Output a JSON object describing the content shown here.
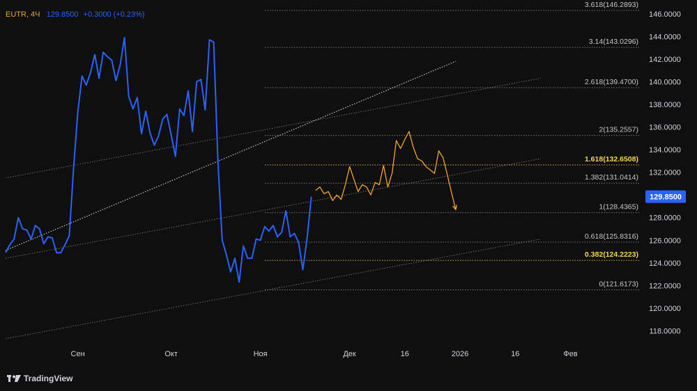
{
  "legend": {
    "symbol": "EUTR, 4Ч",
    "last": "129.8500",
    "change": "+0.3000 (+0.23%)"
  },
  "brand": {
    "name": "TradingView",
    "icon": "tradingview-logo-icon"
  },
  "colors": {
    "background": "#0f0f0f",
    "price_line": "#2962ff",
    "forecast": "#f5a623",
    "fib_level": "#9a9a9a",
    "fib_highlight": "#e3c54a",
    "axis_text": "#d1d4dc",
    "trend_line": "#cfcfcf"
  },
  "chart_data": {
    "type": "line",
    "y_axis": {
      "ylim": [
        116.8,
        146.6
      ],
      "ticks": [
        "118.0000",
        "120.0000",
        "122.0000",
        "124.0000",
        "126.0000",
        "128.0000",
        "130.0000",
        "132.0000",
        "134.0000",
        "136.0000",
        "138.0000",
        "140.0000",
        "142.0000",
        "144.0000",
        "146.0000"
      ],
      "tick_values": [
        118,
        120,
        122,
        124,
        126,
        128,
        130,
        132,
        134,
        136,
        138,
        140,
        142,
        144,
        146
      ],
      "last_price_label": "129.8500",
      "last_price_value": 129.85
    },
    "x_axis": {
      "xlim": [
        0,
        150
      ],
      "ticks": [
        {
          "label": "Сен",
          "x": 17
        },
        {
          "label": "Окт",
          "x": 39
        },
        {
          "label": "Ноя",
          "x": 60
        },
        {
          "label": "Дек",
          "x": 81
        },
        {
          "label": "16",
          "x": 94
        },
        {
          "label": "2026",
          "x": 107
        },
        {
          "label": "16",
          "x": 120
        },
        {
          "label": "Фев",
          "x": 133
        }
      ]
    },
    "series": [
      {
        "role": "price",
        "x": [
          0,
          1,
          2,
          3,
          4,
          5,
          6,
          7,
          8,
          9,
          10,
          11,
          12,
          13,
          14,
          15,
          16,
          17,
          18,
          19,
          20,
          21,
          22,
          23,
          24,
          25,
          26,
          27,
          28,
          29,
          30,
          31,
          32,
          33,
          34,
          35,
          36,
          37,
          38,
          39,
          40,
          41,
          42,
          43,
          44,
          45,
          46,
          47,
          48,
          49,
          50,
          51,
          52,
          53,
          54,
          55,
          56,
          57,
          58,
          59,
          60,
          61,
          62,
          63,
          64,
          65,
          66,
          67,
          68,
          69,
          70,
          71,
          72
        ],
        "values": [
          124.9,
          125.6,
          126.1,
          128.0,
          127.0,
          126.9,
          126.1,
          127.3,
          127.0,
          125.7,
          126.3,
          126.2,
          124.9,
          124.9,
          125.6,
          126.4,
          132.3,
          137.3,
          140.5,
          139.7,
          140.8,
          142.4,
          140.3,
          142.6,
          142.2,
          141.9,
          140.1,
          141.5,
          143.9,
          138.7,
          137.6,
          138.6,
          135.4,
          137.4,
          135.5,
          134.4,
          135.2,
          136.7,
          137.1,
          135.3,
          133.4,
          137.6,
          137.0,
          139.2,
          135.6,
          140.0,
          140.2,
          137.5,
          143.7,
          143.5,
          132.9,
          126.0,
          124.7,
          123.2,
          124.4,
          122.3,
          125.5,
          124.4,
          124.4,
          126.1,
          126.0,
          127.2,
          126.8,
          127.3,
          126.3,
          126.7,
          128.6,
          126.3,
          126.6,
          125.8,
          123.4,
          126.2,
          129.85
        ]
      },
      {
        "role": "forecast",
        "x": [
          73,
          74,
          75,
          76,
          77,
          78,
          79,
          80,
          81,
          82,
          83,
          84,
          85,
          86,
          87,
          88,
          89,
          90,
          91,
          92,
          93,
          94,
          95,
          96,
          97,
          98,
          99,
          100,
          101,
          102,
          103,
          104,
          105,
          106
        ],
        "values": [
          130.4,
          130.7,
          130.1,
          130.3,
          129.5,
          130.0,
          129.6,
          130.9,
          132.5,
          131.4,
          130.3,
          130.9,
          130.7,
          130.0,
          131.1,
          130.9,
          132.6,
          130.7,
          131.9,
          134.8,
          134.1,
          134.9,
          135.6,
          134.2,
          133.2,
          133.0,
          132.5,
          132.2,
          131.9,
          133.9,
          133.3,
          131.8,
          130.2,
          128.7
        ]
      }
    ],
    "fibonacci": {
      "levels": [
        {
          "label": "0(121.6173)",
          "value": 121.6173,
          "highlight": false
        },
        {
          "label": "0.382(124.2223)",
          "value": 124.2223,
          "highlight": true
        },
        {
          "label": "0.618(125.8316)",
          "value": 125.8316,
          "highlight": false
        },
        {
          "label": "1(128.4365)",
          "value": 128.4365,
          "highlight": false
        },
        {
          "label": "1.382(131.0414)",
          "value": 131.0414,
          "highlight": false
        },
        {
          "label": "1.618(132.6508)",
          "value": 132.6508,
          "highlight": true
        },
        {
          "label": "2(135.2557)",
          "value": 135.2557,
          "highlight": false
        },
        {
          "label": "2.618(139.4700)",
          "value": 139.47,
          "highlight": false
        },
        {
          "label": "3.14(143.0296)",
          "value": 143.0296,
          "highlight": false
        },
        {
          "label": "3.618(146.2893)",
          "value": 146.2893,
          "highlight": false
        }
      ]
    },
    "trend_lines": [
      {
        "name": "upper-channel",
        "x1": 0,
        "y1": 131.5,
        "x2": 126,
        "y2": 140.3
      },
      {
        "name": "middle-channel",
        "x1": 0,
        "y1": 124.4,
        "x2": 126,
        "y2": 133.2
      },
      {
        "name": "lower-channel",
        "x1": 0,
        "y1": 117.3,
        "x2": 126,
        "y2": 126.1
      },
      {
        "name": "rising-trendline",
        "x1": 0,
        "y1": 125.1,
        "x2": 106,
        "y2": 141.8
      }
    ]
  }
}
